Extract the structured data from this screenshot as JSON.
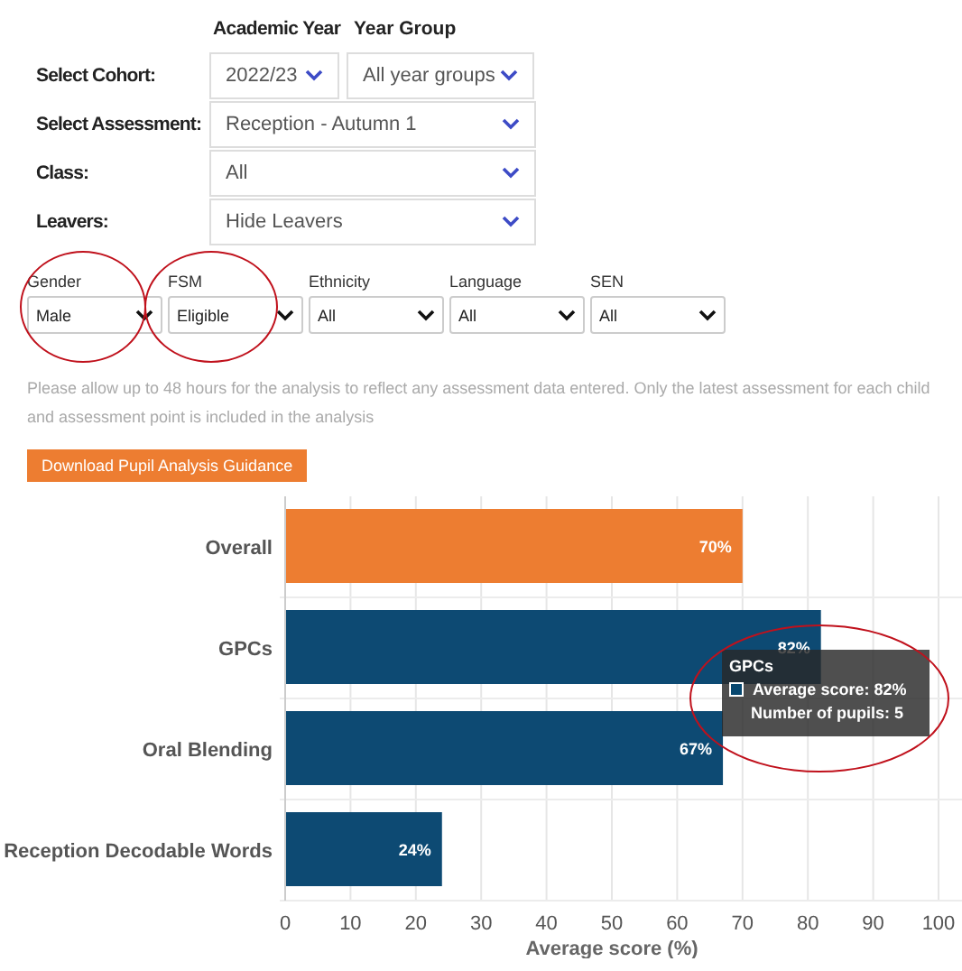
{
  "form": {
    "column_headings": [
      "Academic Year",
      "Year Group"
    ],
    "rows": [
      {
        "label": "Select Cohort:",
        "selects": [
          "2022/23",
          "All year groups"
        ]
      },
      {
        "label": "Select Assessment:",
        "selects": [
          "Reception - Autumn 1"
        ]
      },
      {
        "label": "Class:",
        "selects": [
          "All"
        ]
      },
      {
        "label": "Leavers:",
        "selects": [
          "Hide Leavers"
        ]
      }
    ]
  },
  "filters": [
    {
      "label": "Gender",
      "value": "Male",
      "circled": true
    },
    {
      "label": "FSM",
      "value": "Eligible",
      "circled": true
    },
    {
      "label": "Ethnicity",
      "value": "All",
      "circled": false
    },
    {
      "label": "Language",
      "value": "All",
      "circled": false
    },
    {
      "label": "SEN",
      "value": "All",
      "circled": false
    }
  ],
  "notice": "Please allow up to 48 hours for the analysis to reflect any assessment data entered. Only the latest assessment for each child and assessment point is included in the analysis",
  "guidance_button": "Download Pupil Analysis Guidance",
  "chart": {
    "chart_data": {
      "type": "bar",
      "orientation": "horizontal",
      "xlabel": "Average score (%)",
      "categories": [
        "Overall",
        "GPCs",
        "Oral Blending",
        "Reception Decodable Words"
      ],
      "series": [
        {
          "color": "#ed7d31",
          "values": [
            70,
            null,
            null,
            null
          ]
        },
        {
          "color": "#0d4a73",
          "values": [
            null,
            82,
            67,
            24
          ]
        }
      ],
      "stacked": true,
      "value_labels": [
        "70%",
        "82%",
        "67%",
        "24%"
      ],
      "grid": true,
      "xlim": [
        0,
        100
      ],
      "xticks": [
        0,
        10,
        20,
        30,
        40,
        50,
        60,
        70,
        80,
        90,
        100
      ]
    },
    "tooltip": {
      "title": "GPCs",
      "color": "#07476f",
      "lines": [
        "Average score: 82%",
        "Number of pupils: 5"
      ],
      "circled": true
    }
  }
}
